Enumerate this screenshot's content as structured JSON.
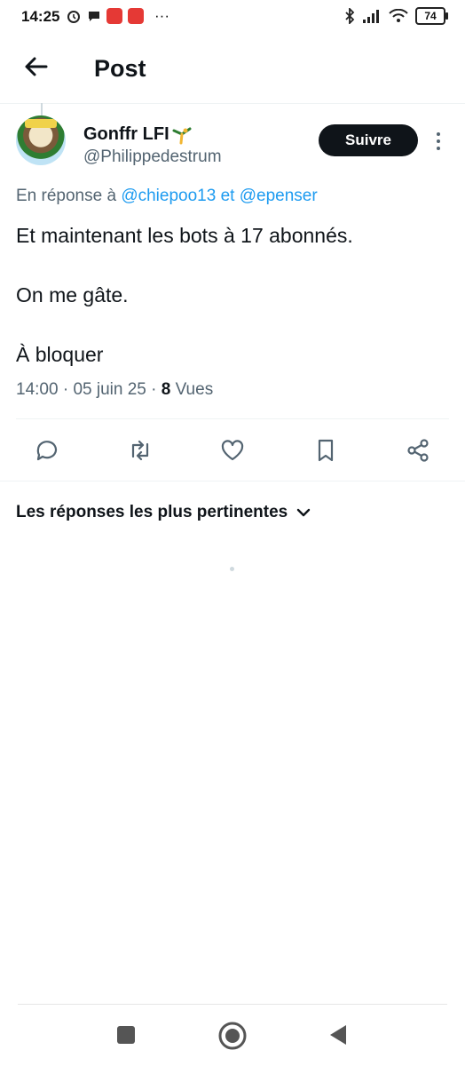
{
  "status_bar": {
    "time": "14:25",
    "more": "···",
    "battery": "74"
  },
  "header": {
    "title": "Post",
    "back_icon": "arrow-left-icon"
  },
  "post": {
    "author": {
      "display_name": "Gonffr LFI",
      "handle": "@Philippedestrum",
      "avatar_icon": "avatar-image"
    },
    "follow_label": "Suivre",
    "reply_to": {
      "prefix": "En réponse à",
      "mention1": "@chiepoo13",
      "joiner": "et",
      "mention2": "@epenser"
    },
    "text": [
      "Et maintenant les bots à 17 abonnés.",
      "On me gâte.",
      "À bloquer"
    ],
    "meta": {
      "time": "14:00",
      "date": "05 juin 25",
      "views_count": "8",
      "views_label": "Vues"
    },
    "actions": [
      "reply-icon",
      "repost-icon",
      "like-icon",
      "bookmark-icon",
      "share-icon"
    ]
  },
  "replies": {
    "sort_label": "Les réponses les plus pertinentes"
  },
  "nav": [
    "recents-button",
    "home-button",
    "back-button"
  ],
  "colors": {
    "accent": "#1d9bf0",
    "text": "#0f1419",
    "secondary": "#536471",
    "follow_bg": "#0f1419"
  }
}
